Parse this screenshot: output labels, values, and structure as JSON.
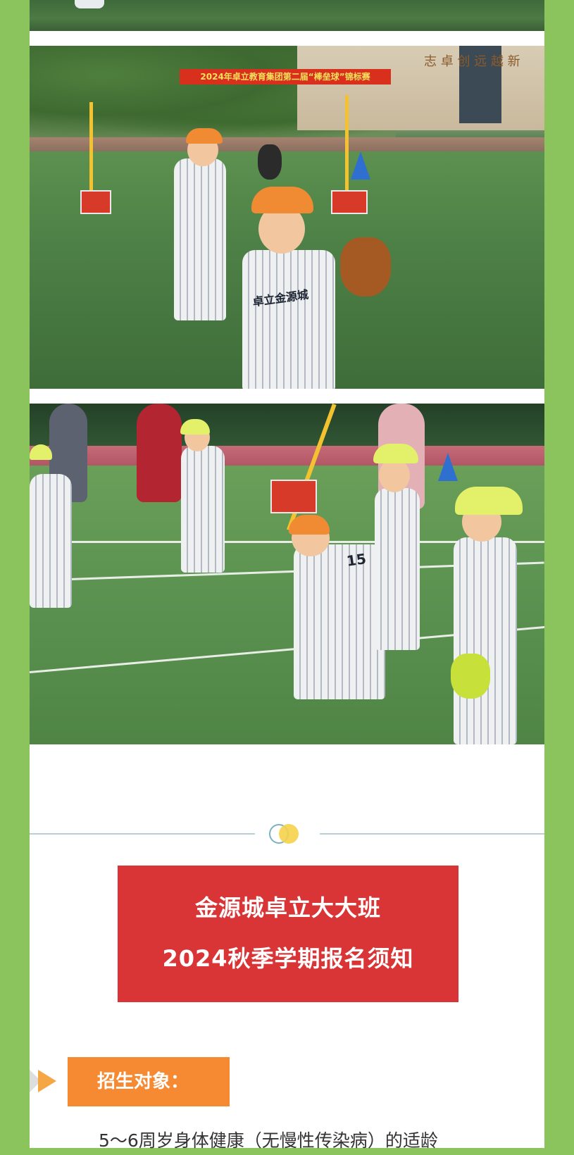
{
  "photos": {
    "photo1": {
      "banner_text": "2024年卓立教育集团第二届“棒垒球”锦标赛",
      "building_chars": "志 卓 创 远 越 新",
      "jersey_text": "卓立金源城"
    },
    "photo2": {
      "jersey_number": "15"
    }
  },
  "notice": {
    "title_line1": "金源城卓立大大班",
    "title_line2": "2024秋季学期报名须知"
  },
  "sections": [
    {
      "heading": "招生对象：",
      "body": "5～6周岁身体健康（无慢性传染病）的适龄"
    }
  ],
  "colors": {
    "page_bg": "#8bc45c",
    "title_bg": "#d93536",
    "heading_bg": "#f58a33"
  }
}
